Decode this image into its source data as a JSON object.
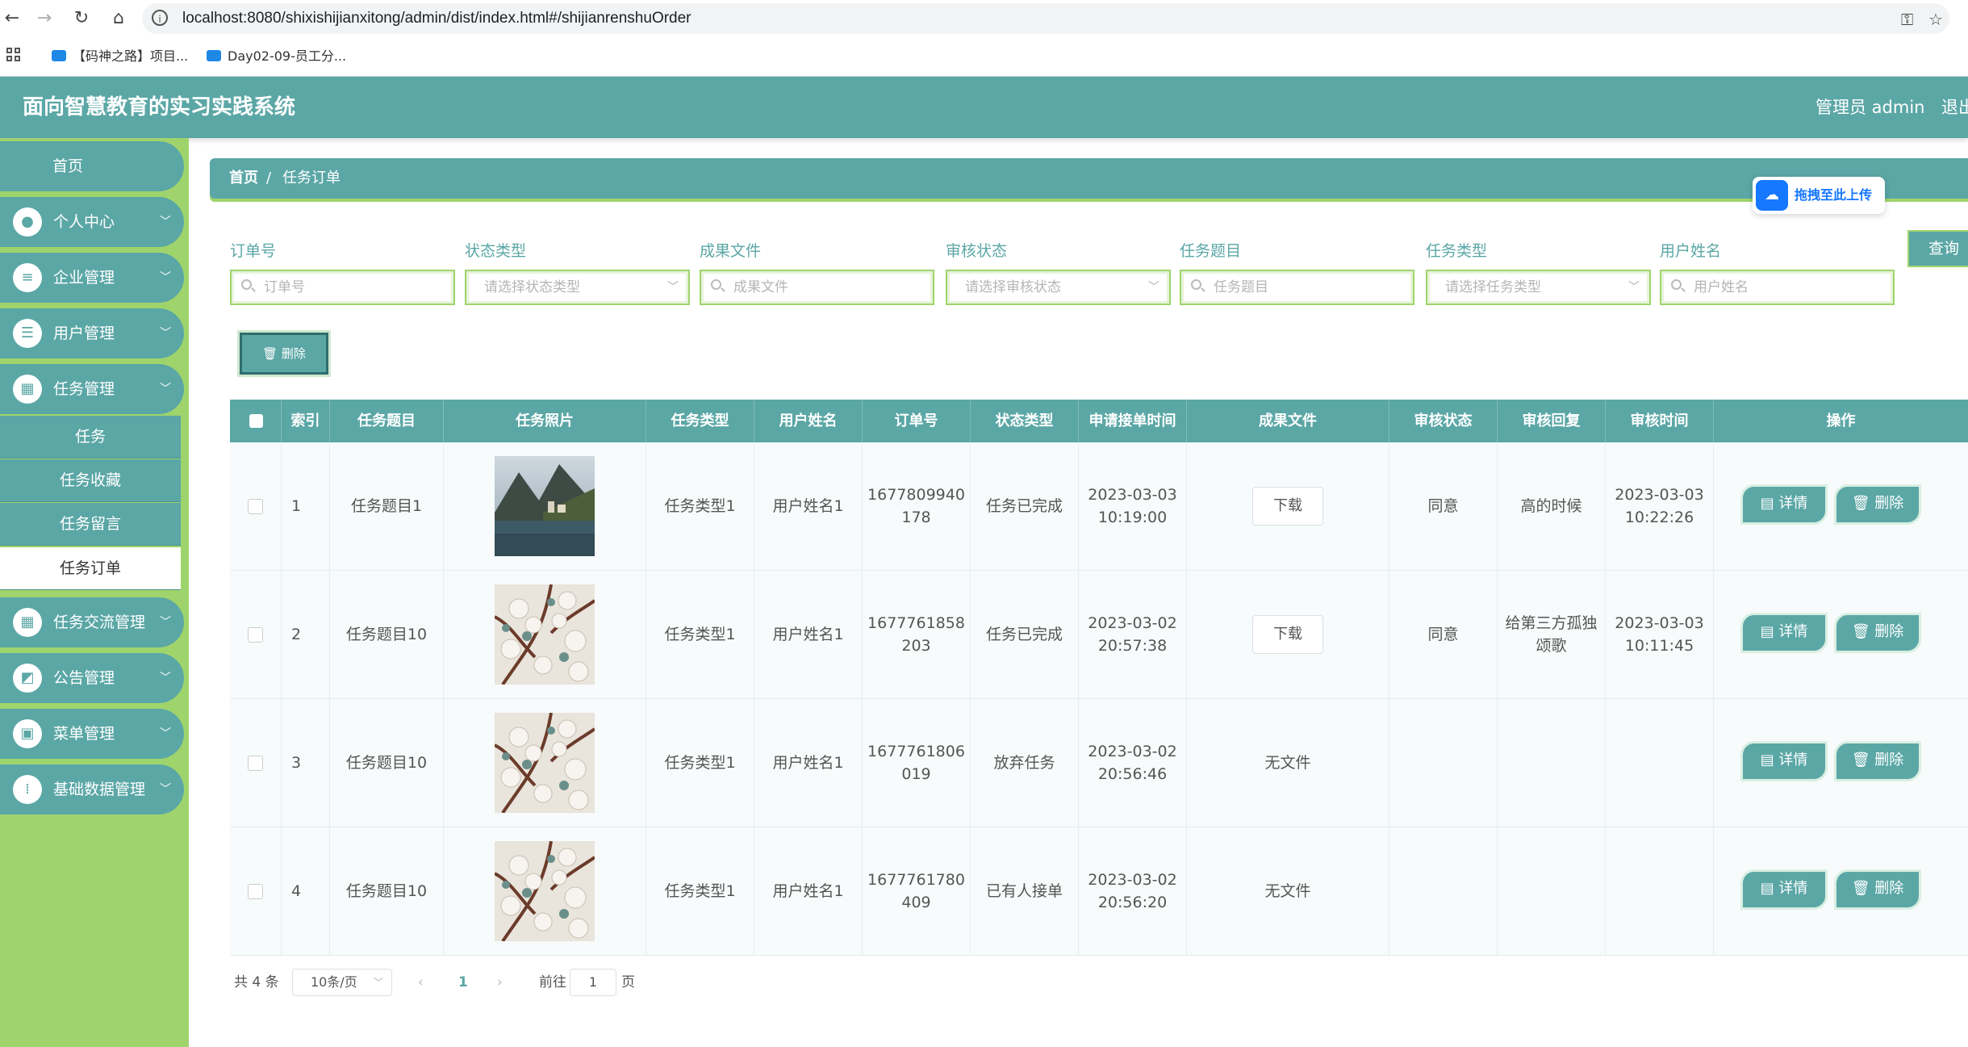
{
  "browser": {
    "url": "localhost:8080/shixishijianxitong/admin/dist/index.html#/shijianrenshuOrder",
    "bookmarks": [
      "【码神之路】项目...",
      "Day02-09-员工分..."
    ]
  },
  "header": {
    "title": "面向智慧教育的实习实践系统",
    "user": "管理员 admin",
    "logout": "退出"
  },
  "sidebar": {
    "home": "首页",
    "items": [
      {
        "label": "个人中心",
        "icon": "user-icon"
      },
      {
        "label": "企业管理",
        "icon": "sliders-icon"
      },
      {
        "label": "用户管理",
        "icon": "list-icon"
      },
      {
        "label": "任务管理",
        "icon": "grid-icon"
      },
      {
        "label": "任务交流管理",
        "icon": "grid-icon"
      },
      {
        "label": "公告管理",
        "icon": "chart-icon"
      },
      {
        "label": "菜单管理",
        "icon": "clipboard-icon"
      },
      {
        "label": "基础数据管理",
        "icon": "apps-icon"
      }
    ],
    "submenu": [
      "任务",
      "任务收藏",
      "任务留言",
      "任务订单"
    ]
  },
  "breadcrumb": {
    "home": "首页",
    "separator": "/",
    "current": "任务订单"
  },
  "upload_widget": {
    "label": "拖拽至此上传"
  },
  "filters": [
    {
      "label": "订单号",
      "placeholder": "订单号",
      "type": "input"
    },
    {
      "label": "状态类型",
      "placeholder": "请选择状态类型",
      "type": "select"
    },
    {
      "label": "成果文件",
      "placeholder": "成果文件",
      "type": "input"
    },
    {
      "label": "审核状态",
      "placeholder": "请选择审核状态",
      "type": "select"
    },
    {
      "label": "任务题目",
      "placeholder": "任务题目",
      "type": "input"
    },
    {
      "label": "任务类型",
      "placeholder": "请选择任务类型",
      "type": "select"
    },
    {
      "label": "用户姓名",
      "placeholder": "用户姓名",
      "type": "input"
    }
  ],
  "query_button": "查询",
  "batch_delete": "删除",
  "table": {
    "columns": [
      "索引",
      "任务题目",
      "任务照片",
      "任务类型",
      "用户姓名",
      "订单号",
      "状态类型",
      "申请接单时间",
      "成果文件",
      "审核状态",
      "审核回复",
      "审核时间",
      "操作"
    ],
    "rows": [
      {
        "index": "1",
        "title": "任务题目1",
        "photo": "lake-village",
        "type": "任务类型1",
        "user": "用户姓名1",
        "order_no": "1677809940178",
        "order_line1": "1677809940",
        "order_line2": "178",
        "status": "任务已完成",
        "apply_date": "2023-03-03",
        "apply_time": "10:19:00",
        "file": "下载",
        "audit": "同意",
        "reply": "高的时候",
        "audit_date": "2023-03-03",
        "audit_time": "10:22:26"
      },
      {
        "index": "2",
        "title": "任务题目10",
        "photo": "blossom",
        "type": "任务类型1",
        "user": "用户姓名1",
        "order_no": "1677761858203",
        "order_line1": "1677761858",
        "order_line2": "203",
        "status": "任务已完成",
        "apply_date": "2023-03-02",
        "apply_time": "20:57:38",
        "file": "下载",
        "audit": "同意",
        "reply": "给第三方孤独颂歌",
        "reply_line1": "给第三方孤独",
        "reply_line2": "颂歌",
        "audit_date": "2023-03-03",
        "audit_time": "10:11:45"
      },
      {
        "index": "3",
        "title": "任务题目10",
        "photo": "blossom",
        "type": "任务类型1",
        "user": "用户姓名1",
        "order_no": "1677761806019",
        "order_line1": "1677761806",
        "order_line2": "019",
        "status": "放弃任务",
        "apply_date": "2023-03-02",
        "apply_time": "20:56:46",
        "file": "无文件",
        "audit": "",
        "reply": "",
        "audit_date": "",
        "audit_time": ""
      },
      {
        "index": "4",
        "title": "任务题目10",
        "photo": "blossom",
        "type": "任务类型1",
        "user": "用户姓名1",
        "order_no": "1677761780409",
        "order_line1": "1677761780",
        "order_line2": "409",
        "status": "已有人接单",
        "apply_date": "2023-03-02",
        "apply_time": "20:56:20",
        "file": "无文件",
        "audit": "",
        "reply": "",
        "audit_date": "",
        "audit_time": ""
      }
    ],
    "actions": {
      "detail": "详情",
      "delete": "删除"
    }
  },
  "pagination": {
    "total": "共 4 条",
    "page_size": "10条/页",
    "current_page": "1",
    "goto_prefix": "前往",
    "goto_value": "1",
    "goto_suffix": "页"
  },
  "colors": {
    "primary": "#5ba7a6",
    "sidebar": "#9fd46c",
    "accent_blue": "#1677ff"
  }
}
